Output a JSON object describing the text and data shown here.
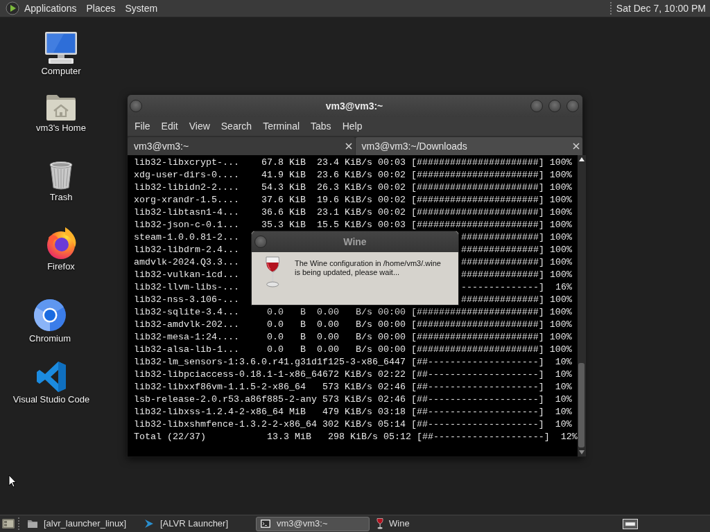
{
  "top_panel": {
    "menus": [
      "Applications",
      "Places",
      "System"
    ],
    "clock": "Sat Dec 7, 10:00 PM"
  },
  "desktop_icons": [
    {
      "label": "Computer",
      "kind": "computer"
    },
    {
      "label": "vm3's Home",
      "kind": "home"
    },
    {
      "label": "Trash",
      "kind": "trash"
    },
    {
      "label": "Firefox",
      "kind": "firefox"
    },
    {
      "label": "Chromium",
      "kind": "chromium"
    },
    {
      "label": "Visual Studio Code",
      "kind": "vscode"
    }
  ],
  "terminal_window": {
    "title": "vm3@vm3:~",
    "menu": [
      "File",
      "Edit",
      "View",
      "Search",
      "Terminal",
      "Tabs",
      "Help"
    ],
    "tabs": [
      {
        "label": "vm3@vm3:~",
        "selected": true
      },
      {
        "label": "vm3@vm3:~/Downloads",
        "selected": false
      }
    ],
    "lines": [
      {
        "kind": "full",
        "text": "lib32-libxcrypt-...    67.8 KiB  23.4 KiB/s 00:03 [######################] 100%"
      },
      {
        "kind": "full",
        "text": "xdg-user-dirs-0....    41.9 KiB  23.6 KiB/s 00:02 [######################] 100%"
      },
      {
        "kind": "full",
        "text": "lib32-libidn2-2....    54.3 KiB  26.3 KiB/s 00:02 [######################] 100%"
      },
      {
        "kind": "full",
        "text": "xorg-xrandr-1.5....    37.6 KiB  19.6 KiB/s 00:02 [######################] 100%"
      },
      {
        "kind": "full",
        "text": "lib32-libtasn1-4...    36.6 KiB  23.1 KiB/s 00:02 [######################] 100%"
      },
      {
        "kind": "full",
        "text": "lib32-json-c-0.1...    35.3 KiB  15.5 KiB/s 00:03 [######################] 100%"
      },
      {
        "kind": "split",
        "start": "steam-1.0.0.81-2...",
        "end": "##############] 100%"
      },
      {
        "kind": "split",
        "start": "lib32-libdrm-2.4...",
        "end": "##############] 100%"
      },
      {
        "kind": "split",
        "start": "amdvlk-2024.Q3.3...",
        "end": "##############] 100%"
      },
      {
        "kind": "split",
        "start": "lib32-vulkan-icd...",
        "end": "##############] 100%"
      },
      {
        "kind": "split",
        "start": "lib32-llvm-libs-...",
        "end": "--------------]  16%"
      },
      {
        "kind": "split",
        "start": "lib32-nss-3.106-...",
        "end": "##############] 100%"
      },
      {
        "kind": "full",
        "text": "lib32-sqlite-3.4...     0.0   B  0.00   B/s 00:00 [######################] 100%"
      },
      {
        "kind": "full",
        "text": "lib32-amdvlk-202...     0.0   B  0.00   B/s 00:00 [######################] 100%"
      },
      {
        "kind": "full",
        "text": "lib32-mesa-1:24....     0.0   B  0.00   B/s 00:00 [######################] 100%"
      },
      {
        "kind": "full",
        "text": "lib32-alsa-lib-1...     0.0   B  0.00   B/s 00:00 [######################] 100%"
      },
      {
        "kind": "full",
        "text": "lib32-lm_sensors-1:3.6.0.r41.g31d1f125-3-x86_6447 [##--------------------]  10%"
      },
      {
        "kind": "full",
        "text": "lib32-libpciaccess-0.18.1-1-x86_64672 KiB/s 02:22 [##--------------------]  10%"
      },
      {
        "kind": "full",
        "text": "lib32-libxxf86vm-1.1.5-2-x86_64   573 KiB/s 02:46 [##--------------------]  10%"
      },
      {
        "kind": "full",
        "text": "lsb-release-2.0.r53.a86f885-2-any 573 KiB/s 02:46 [##--------------------]  10%"
      },
      {
        "kind": "full",
        "text": "lib32-libxss-1.2.4-2-x86_64 MiB   479 KiB/s 03:18 [##--------------------]  10%"
      },
      {
        "kind": "full",
        "text": "lib32-libxshmfence-1.3.2-2-x86_64 302 KiB/s 05:14 [##--------------------]  10%"
      },
      {
        "kind": "full",
        "text": "Total (22/37)           13.3 MiB   298 KiB/s 05:12 [##--------------------]  12%"
      }
    ]
  },
  "wine_dialog": {
    "title": "Wine",
    "message": "The Wine configuration in /home/vm3/.wine is being updated, please wait..."
  },
  "taskbar": {
    "items": [
      {
        "label": "[alvr_launcher_linux]",
        "kind": "folder",
        "selected": false
      },
      {
        "label": "[ALVR Launcher]",
        "kind": "launcher",
        "selected": false
      },
      {
        "label": "vm3@vm3:~",
        "kind": "terminal",
        "selected": true
      },
      {
        "label": "Wine",
        "kind": "wine",
        "selected": false
      }
    ]
  }
}
